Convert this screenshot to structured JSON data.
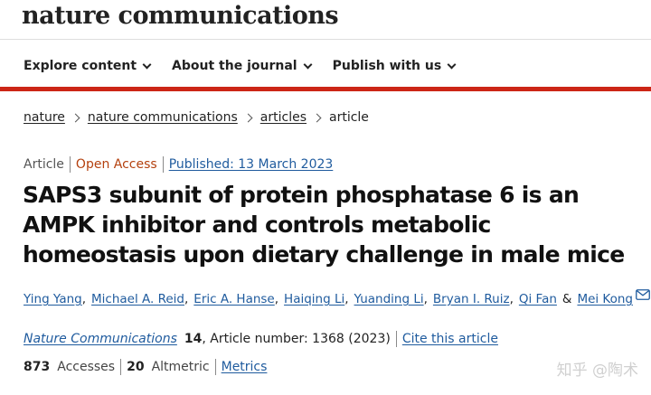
{
  "site": {
    "logo": "nature communications"
  },
  "nav": {
    "items": [
      {
        "label": "Explore content"
      },
      {
        "label": "About the journal"
      },
      {
        "label": "Publish with us"
      }
    ]
  },
  "breadcrumb": {
    "items": [
      "nature",
      "nature communications",
      "articles"
    ],
    "current": "article"
  },
  "article": {
    "type": "Article",
    "access": "Open Access",
    "published": "Published: 13 March 2023",
    "title": "SAPS3 subunit of protein phosphatase 6 is an AMPK inhibitor and controls metabolic homeostasis upon dietary challenge in male mice",
    "authors": [
      "Ying Yang",
      "Michael A. Reid",
      "Eric A. Hanse",
      "Haiqing Li",
      "Yuanding Li",
      "Bryan I. Ruiz",
      "Qi Fan"
    ],
    "last_author": "Mei Kong",
    "amp": "&",
    "journal": "Nature Communications",
    "volume": "14",
    "article_number": ", Article number: 1368 (2023)",
    "cite": "Cite this article"
  },
  "metrics": {
    "accesses": "873",
    "accesses_label": "Accesses",
    "altmetric": "20",
    "altmetric_label": "Altmetric",
    "link": "Metrics"
  },
  "watermark": "知乎 @陶术",
  "colors": {
    "accent": "#cc2616",
    "link": "#1f5b9e",
    "open_access": "#b4410f"
  }
}
